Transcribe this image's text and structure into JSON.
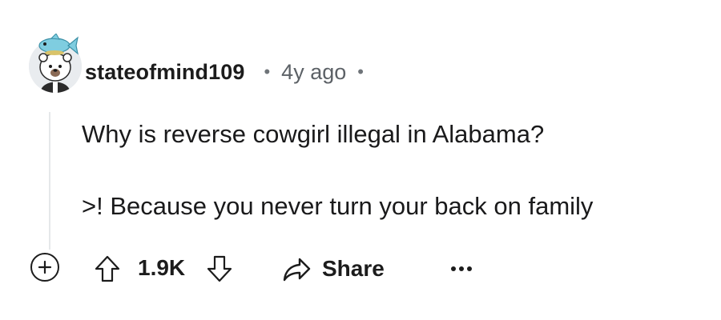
{
  "comment": {
    "author": "stateofmind109",
    "age": "4y ago",
    "separator": "•",
    "body": {
      "line1": "Why is reverse cowgirl illegal in Alabama?",
      "line2": ">! Because you never turn your back on family"
    }
  },
  "actions": {
    "score": "1.9K",
    "share_label": "Share",
    "icons": {
      "expand": "plus-circle-icon",
      "upvote": "arrow-up-icon",
      "downvote": "arrow-down-icon",
      "share": "share-arrow-icon",
      "more": "ellipsis-icon"
    }
  },
  "colors": {
    "text": "#1c1c1c",
    "muted": "#5c6166",
    "thread_line": "#e5e8ea",
    "avatar_bg": "#e9ecef",
    "fish": "#7fcde0"
  }
}
